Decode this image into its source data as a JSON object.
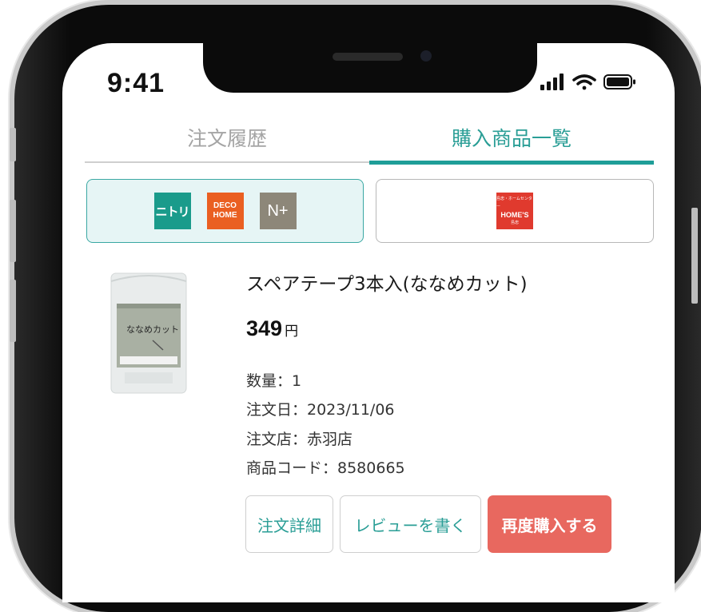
{
  "status_bar": {
    "time": "9:41"
  },
  "tabs": [
    {
      "label": "注文履歴",
      "active": false
    },
    {
      "label": "購入商品一覧",
      "active": true
    }
  ],
  "stores": {
    "nitori_group": {
      "selected": true,
      "logos": [
        {
          "name": "nitori-logo",
          "text": "ニトリ",
          "color": "#1a9b8b"
        },
        {
          "name": "deco-home-logo",
          "text_top": "DECO",
          "text_bottom": "HOME",
          "color": "#ea5f21"
        },
        {
          "name": "n-plus-logo",
          "text": "N+",
          "color": "#8d8779"
        }
      ]
    },
    "homes": {
      "selected": false,
      "logo": {
        "name": "homes-logo",
        "text_top": "島忠・ホームセンター",
        "text_main": "HOME'S",
        "text_bottom": "島忠",
        "color": "#e03a2e"
      }
    }
  },
  "product": {
    "name": "スペアテープ3本入(ななめカット)",
    "price": "349",
    "price_unit": "円",
    "quantity": "数量：1",
    "order_date": "注文日：2023/11/06",
    "order_store": "注文店：赤羽店",
    "product_code": "商品コード：8580665",
    "image_label": "ななめカット"
  },
  "actions": {
    "order_detail": "注文詳細",
    "write_review": "レビューを書く",
    "rebuy": "再度購入する"
  },
  "colors": {
    "accent": "#1f9e98",
    "rebuy": "#e8685f",
    "selected_store_bg": "#e6f5f5"
  }
}
